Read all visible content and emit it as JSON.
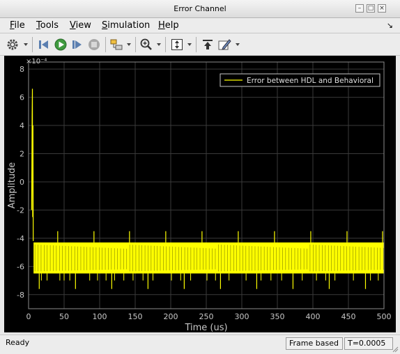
{
  "window": {
    "title": "Error Channel",
    "buttons": [
      "–",
      "□",
      "×"
    ]
  },
  "menu": [
    {
      "label": "File",
      "key": "F",
      "rest": "ile"
    },
    {
      "label": "Tools",
      "key": "T",
      "rest": "ools"
    },
    {
      "label": "View",
      "key": "V",
      "rest": "iew"
    },
    {
      "label": "Simulation",
      "key": "S",
      "rest": "imulation"
    },
    {
      "label": "Help",
      "key": "H",
      "rest": "elp"
    }
  ],
  "menu_dock_icon": "↘",
  "toolbar": {
    "buttons": [
      "settings-icon",
      "step-back-icon",
      "run-icon",
      "step-forward-icon",
      "stop-icon",
      "highlight-block-icon",
      "zoom-in-icon",
      "autoscale-icon",
      "restore-view-icon",
      "style-icon"
    ]
  },
  "colors": {
    "plot_background": "#000000",
    "grid": "#3a3a3a",
    "axes_text": "#c8c8c8",
    "signal": "#ffff00"
  },
  "chart_data": {
    "type": "line",
    "xlabel": "Time (us)",
    "ylabel": "Amplitude",
    "exponent_label": "×10⁻⁴",
    "xlim": [
      0,
      500
    ],
    "ylim": [
      -9,
      8.5
    ],
    "x_ticks": [
      0,
      50,
      100,
      150,
      200,
      250,
      300,
      350,
      400,
      450,
      500
    ],
    "y_ticks": [
      -8,
      -6,
      -4,
      -2,
      0,
      2,
      4,
      6,
      8
    ],
    "grid": true,
    "legend_position": "top-right",
    "series": [
      {
        "name": "Error between HDL and Behavioral",
        "color": "#ffff00",
        "initial_transient": [
          [
            4.2,
            -2.0
          ],
          [
            4.6,
            1.0
          ],
          [
            5.0,
            4.7
          ],
          [
            5.4,
            6.6
          ],
          [
            5.8,
            -2.5
          ],
          [
            6.2,
            4.0
          ],
          [
            6.6,
            -4.2
          ]
        ],
        "band": [
          -6.5,
          -4.3
        ],
        "upper_spikes_x": [
          41,
          92,
          142,
          193,
          244,
          295,
          346,
          397,
          448,
          498
        ],
        "upper_spike_y": -3.5,
        "lower_spikes_x": [
          15,
          66,
          117,
          168,
          219,
          270,
          321,
          372,
          423,
          474
        ],
        "lower_spike_y": -7.6,
        "small_dips_x": [
          18,
          26,
          44,
          50,
          58,
          86,
          97,
          109,
          121,
          134,
          147,
          161,
          175,
          201,
          214,
          228,
          251,
          263,
          282,
          306,
          327,
          341,
          356,
          385,
          405,
          418,
          431,
          457,
          481,
          492
        ],
        "small_dip_y": -7.0,
        "range": [
          7,
          500
        ]
      }
    ]
  },
  "status": {
    "left": "Ready",
    "mode": "Frame based",
    "time": "T=0.0005"
  }
}
